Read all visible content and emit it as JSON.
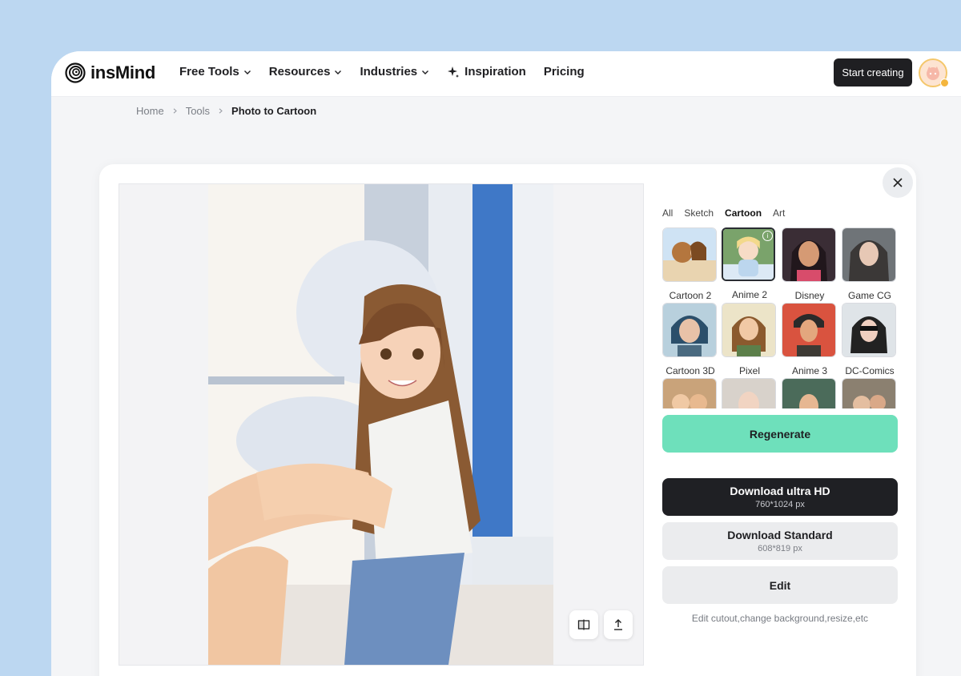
{
  "brand": {
    "name": "insMind"
  },
  "nav": [
    {
      "label": "Free Tools",
      "dropdown": true
    },
    {
      "label": "Resources",
      "dropdown": true
    },
    {
      "label": "Industries",
      "dropdown": true
    },
    {
      "label": "Inspiration",
      "icon": "sparkle-icon"
    },
    {
      "label": "Pricing"
    }
  ],
  "header": {
    "start_label": "Start creating"
  },
  "breadcrumb": {
    "home": "Home",
    "tools": "Tools",
    "current": "Photo to Cartoon"
  },
  "tabs": [
    {
      "label": "All"
    },
    {
      "label": "Sketch"
    },
    {
      "label": "Cartoon",
      "active": true
    },
    {
      "label": "Art"
    }
  ],
  "styles": [
    {
      "label": "Cartoon 2"
    },
    {
      "label": "Anime 2",
      "selected": true
    },
    {
      "label": "Disney"
    },
    {
      "label": "Game CG"
    },
    {
      "label": "Cartoon 3D"
    },
    {
      "label": "Pixel"
    },
    {
      "label": "Anime 3"
    },
    {
      "label": "DC-Comics"
    },
    {
      "label": ""
    },
    {
      "label": ""
    },
    {
      "label": ""
    },
    {
      "label": ""
    }
  ],
  "actions": {
    "regenerate": "Regenerate",
    "download_hd": {
      "label": "Download ultra HD",
      "size": "760*1024 px"
    },
    "download_std": {
      "label": "Download Standard",
      "size": "608*819 px"
    },
    "edit": "Edit",
    "edit_hint": "Edit cutout,change background,resize,etc"
  },
  "colors": {
    "accent": "#6ee0bb",
    "dark": "#1f2024",
    "page_bg": "#bcd7f1"
  }
}
